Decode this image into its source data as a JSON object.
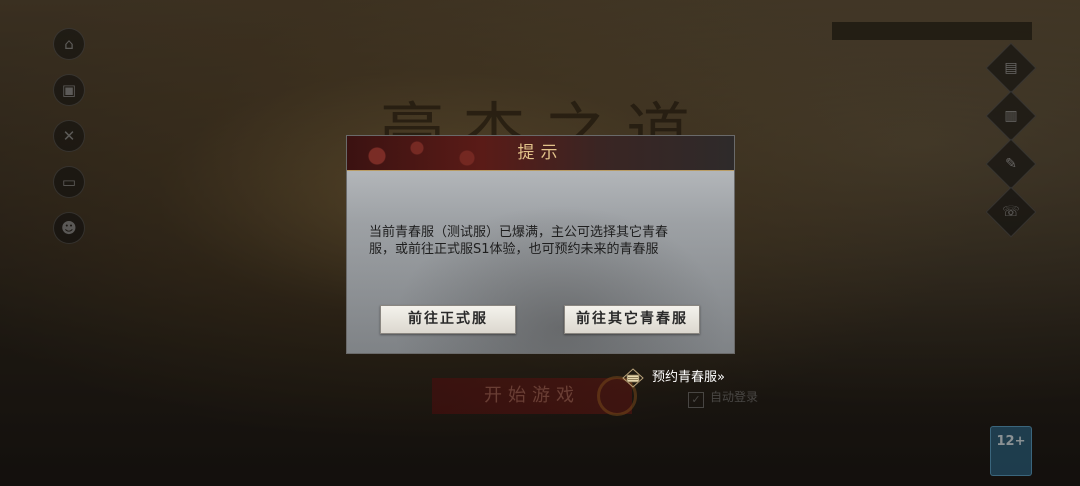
{
  "background": {
    "game_title": "豪杰之道",
    "top_notice": "",
    "left_icons": [
      "house-icon",
      "gift-icon",
      "tools-icon",
      "news-icon",
      "user-icon"
    ],
    "right_icons": [
      "announce-icon",
      "notice-icon",
      "settings-icon",
      "service-icon"
    ],
    "start_button": "开始游戏",
    "auto_login": "自动登录",
    "age_rating": "12+",
    "footer": "",
    "footer_left": ""
  },
  "dialog": {
    "title": "提示",
    "message_line1": "当前青春服（测试服）已爆满，主公可选择其它青春",
    "message_line2": "服，或前往正式服S1体验，也可预约未来的青春服",
    "btn_formal": "前往正式服",
    "btn_other": "前往其它青春服"
  },
  "reserve": {
    "label": "预约青春服",
    "arrow": "»"
  }
}
